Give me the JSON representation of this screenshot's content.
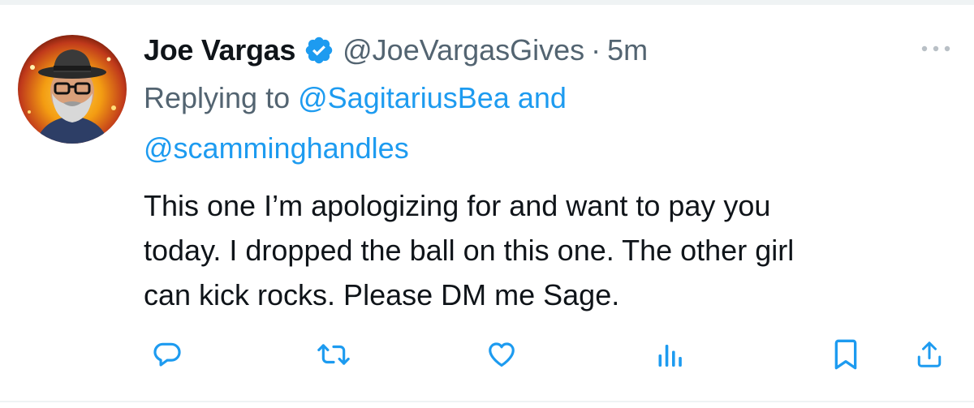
{
  "tweet": {
    "author": {
      "display_name": "Joe Vargas",
      "handle": "@JoeVargasGives",
      "verified": true,
      "verified_color": "#1d9bf0",
      "avatar_icon": "bearded-man-with-hat-avatar"
    },
    "separator": "·",
    "timestamp": "5m",
    "more_icon": "more-dots-icon",
    "replying": {
      "prefix": "Replying to",
      "mention_1": "@SagitariusBea",
      "conjunction": "and",
      "mention_2": "@scamminghandles"
    },
    "text_lines": [
      "This one I’m apologizing for and want to pay you",
      "today. I dropped the ball on this one. The other girl",
      "can kick rocks. Please DM me Sage."
    ],
    "actions": [
      {
        "name": "reply",
        "icon": "reply-icon"
      },
      {
        "name": "retweet",
        "icon": "retweet-icon"
      },
      {
        "name": "like",
        "icon": "heart-icon"
      },
      {
        "name": "views",
        "icon": "views-chart-icon"
      },
      {
        "name": "bookmark",
        "icon": "bookmark-icon"
      },
      {
        "name": "share",
        "icon": "share-icon"
      }
    ]
  },
  "colors": {
    "text_primary": "#0f1419",
    "text_secondary": "#536471",
    "link": "#1d9bf0"
  }
}
